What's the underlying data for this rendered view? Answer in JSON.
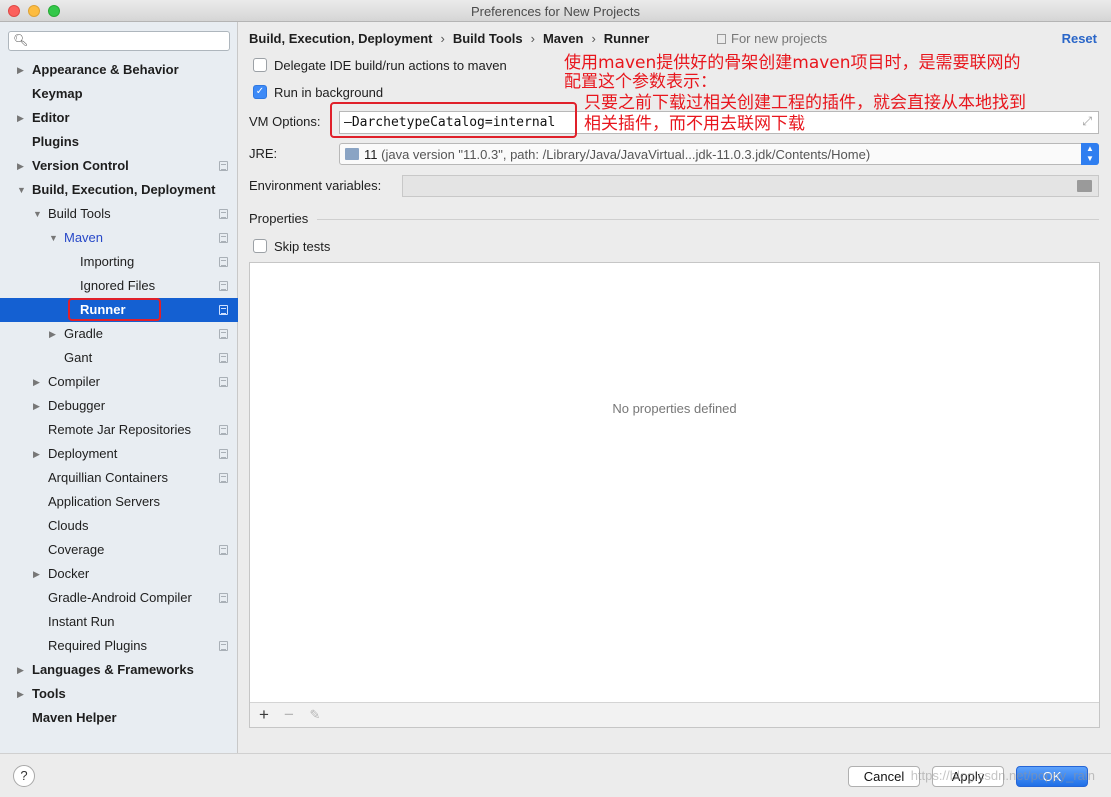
{
  "window": {
    "title": "Preferences for New Projects"
  },
  "search": {
    "placeholder": "",
    "icon": "search-icon"
  },
  "sidebar": {
    "items": [
      {
        "label": "Appearance & Behavior",
        "level": 0,
        "arrow": "right",
        "bold": true,
        "page_icon": false
      },
      {
        "label": "Keymap",
        "level": 0,
        "arrow": "",
        "bold": true,
        "page_icon": false
      },
      {
        "label": "Editor",
        "level": 0,
        "arrow": "right",
        "bold": true,
        "page_icon": false
      },
      {
        "label": "Plugins",
        "level": 0,
        "arrow": "",
        "bold": true,
        "page_icon": false
      },
      {
        "label": "Version Control",
        "level": 0,
        "arrow": "right",
        "bold": true,
        "page_icon": true
      },
      {
        "label": "Build, Execution, Deployment",
        "level": 0,
        "arrow": "down",
        "bold": true,
        "page_icon": false
      },
      {
        "label": "Build Tools",
        "level": 1,
        "arrow": "down",
        "bold": false,
        "page_icon": true
      },
      {
        "label": "Maven",
        "level": 2,
        "arrow": "down",
        "bold": false,
        "page_icon": true,
        "blue": true
      },
      {
        "label": "Importing",
        "level": 3,
        "arrow": "",
        "bold": false,
        "page_icon": true
      },
      {
        "label": "Ignored Files",
        "level": 3,
        "arrow": "",
        "bold": false,
        "page_icon": true
      },
      {
        "label": "Runner",
        "level": 3,
        "arrow": "",
        "bold": false,
        "page_icon": true,
        "selected": true
      },
      {
        "label": "Gradle",
        "level": 2,
        "arrow": "right",
        "bold": false,
        "page_icon": true
      },
      {
        "label": "Gant",
        "level": 2,
        "arrow": "",
        "bold": false,
        "page_icon": true
      },
      {
        "label": "Compiler",
        "level": 1,
        "arrow": "right",
        "bold": false,
        "page_icon": true
      },
      {
        "label": "Debugger",
        "level": 1,
        "arrow": "right",
        "bold": false,
        "page_icon": false
      },
      {
        "label": "Remote Jar Repositories",
        "level": 1,
        "arrow": "",
        "bold": false,
        "page_icon": true
      },
      {
        "label": "Deployment",
        "level": 1,
        "arrow": "right",
        "bold": false,
        "page_icon": true
      },
      {
        "label": "Arquillian Containers",
        "level": 1,
        "arrow": "",
        "bold": false,
        "page_icon": true
      },
      {
        "label": "Application Servers",
        "level": 1,
        "arrow": "",
        "bold": false,
        "page_icon": false
      },
      {
        "label": "Clouds",
        "level": 1,
        "arrow": "",
        "bold": false,
        "page_icon": false
      },
      {
        "label": "Coverage",
        "level": 1,
        "arrow": "",
        "bold": false,
        "page_icon": true
      },
      {
        "label": "Docker",
        "level": 1,
        "arrow": "right",
        "bold": false,
        "page_icon": false
      },
      {
        "label": "Gradle-Android Compiler",
        "level": 1,
        "arrow": "",
        "bold": false,
        "page_icon": true
      },
      {
        "label": "Instant Run",
        "level": 1,
        "arrow": "",
        "bold": false,
        "page_icon": false
      },
      {
        "label": "Required Plugins",
        "level": 1,
        "arrow": "",
        "bold": false,
        "page_icon": true
      },
      {
        "label": "Languages & Frameworks",
        "level": 0,
        "arrow": "right",
        "bold": true,
        "page_icon": false
      },
      {
        "label": "Tools",
        "level": 0,
        "arrow": "right",
        "bold": true,
        "page_icon": false
      },
      {
        "label": "Maven Helper",
        "level": 0,
        "arrow": "",
        "bold": true,
        "page_icon": false
      }
    ]
  },
  "header": {
    "breadcrumb": [
      "Build, Execution, Deployment",
      "Build Tools",
      "Maven",
      "Runner"
    ],
    "breadcrumb_sep": "›",
    "scope_note": "For new projects",
    "reset_label": "Reset"
  },
  "options": {
    "delegate_label": "Delegate IDE build/run actions to maven",
    "delegate_checked": false,
    "background_label": "Run in background",
    "background_checked": true,
    "vm_label": "VM Options:",
    "vm_value": "–DarchetypeCatalog=internal",
    "jre_label": "JRE:",
    "jre_version": "11",
    "jre_detail": "(java version \"11.0.3\", path: /Library/Java/JavaVirtual...jdk-11.0.3.jdk/Contents/Home)",
    "env_label": "Environment variables:",
    "env_value": ""
  },
  "properties": {
    "title": "Properties",
    "skip_tests_label": "Skip tests",
    "skip_tests_checked": false,
    "empty_text": "No properties defined",
    "add_symbol": "+",
    "remove_symbol": "−",
    "edit_symbol": "✎"
  },
  "annotation": {
    "line1": "使用maven提供好的骨架创建maven项目时，是需要联网的",
    "line2": "配置这个参数表示：",
    "line3": "只要之前下载过相关创建工程的插件，就会直接从本地找到",
    "line4": "相关插件，而不用去联网下载",
    "color": "#e8161d"
  },
  "footer": {
    "help_label": "?",
    "cancel_label": "Cancel",
    "apply_label": "Apply",
    "ok_label": "OK",
    "watermark": "https://blog.csdn.net/poppy_rain"
  },
  "colors": {
    "accent": "#1460d2",
    "ok_button": "#1f6fe7",
    "highlight_box": "#e0202a"
  }
}
